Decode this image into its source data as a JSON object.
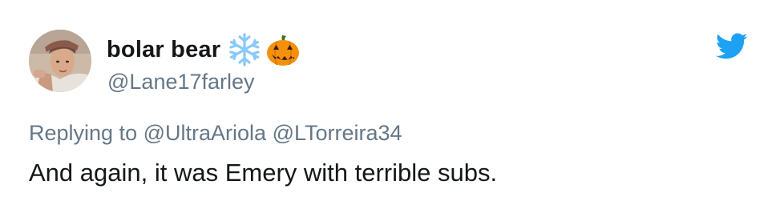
{
  "tweet": {
    "author": {
      "display_name": "bolar bear",
      "handle": "@Lane17farley",
      "avatar_icon": "user-avatar-photo",
      "name_emojis": [
        "snowflake-icon",
        "jack-o-lantern-icon"
      ]
    },
    "reply_prefix": "Replying to",
    "reply_mentions": [
      "@UltraAriola",
      "@LTorreira34"
    ],
    "text": "And again, it was Emery with terrible subs.",
    "brand_icon": "twitter-bird-icon",
    "colors": {
      "brand_blue": "#1da1f2",
      "name_text": "#14171a",
      "secondary_text": "#657786",
      "pumpkin_orange": "#f4900c",
      "snowflake_blue": "#88c9f9"
    }
  }
}
